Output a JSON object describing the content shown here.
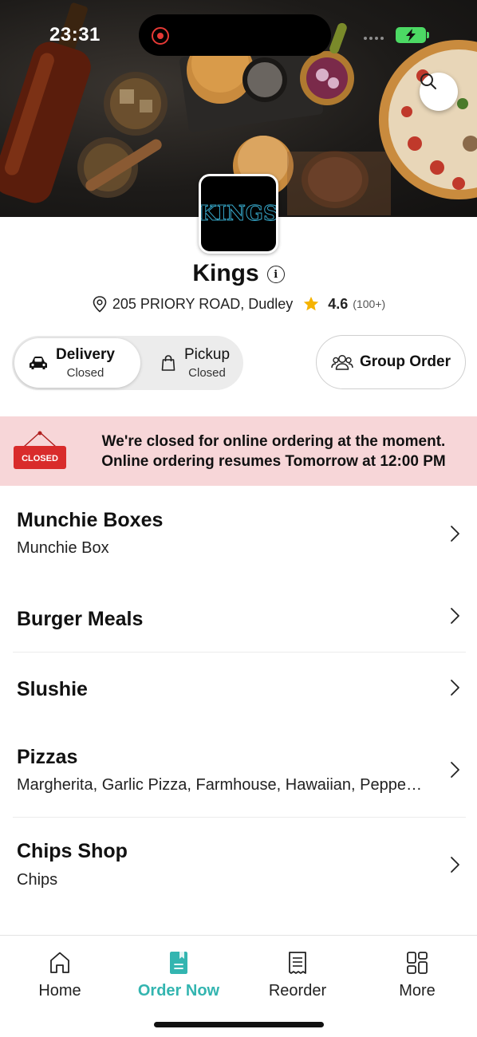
{
  "status_bar": {
    "time": "23:31"
  },
  "store": {
    "logo_text": "KINGS",
    "name": "Kings",
    "address": "205 PRIORY ROAD, Dudley",
    "rating": "4.6",
    "review_count": "(100+)"
  },
  "order_mode": {
    "delivery_label": "Delivery",
    "delivery_status": "Closed",
    "pickup_label": "Pickup",
    "pickup_status": "Closed",
    "selected": "Delivery",
    "group_order_label": "Group Order"
  },
  "closed_banner": {
    "sign_text": "CLOSED",
    "line1": "We're closed for online ordering at the moment.",
    "line2": "Online ordering resumes Tomorrow at 12:00 PM"
  },
  "categories": [
    {
      "title": "Munchie Boxes",
      "subtitle": "Munchie Box"
    },
    {
      "title": "Burger Meals",
      "subtitle": ""
    },
    {
      "title": "Slushie",
      "subtitle": ""
    },
    {
      "title": "Pizzas",
      "subtitle": "Margherita, Garlic Pizza, Farmhouse, Hawaiian, Peppe…"
    },
    {
      "title": "Chips Shop",
      "subtitle": "Chips"
    }
  ],
  "tab_bar": {
    "items": [
      {
        "label": "Home",
        "icon": "home-icon"
      },
      {
        "label": "Order Now",
        "icon": "order-icon"
      },
      {
        "label": "Reorder",
        "icon": "receipt-icon"
      },
      {
        "label": "More",
        "icon": "grid-icon"
      }
    ],
    "active": "Order Now"
  },
  "colors": {
    "accent": "#33b5b0",
    "closed_banner_bg": "#f7d6d8",
    "closed_sign": "#d92b2b",
    "rating_star": "#f5b301"
  }
}
